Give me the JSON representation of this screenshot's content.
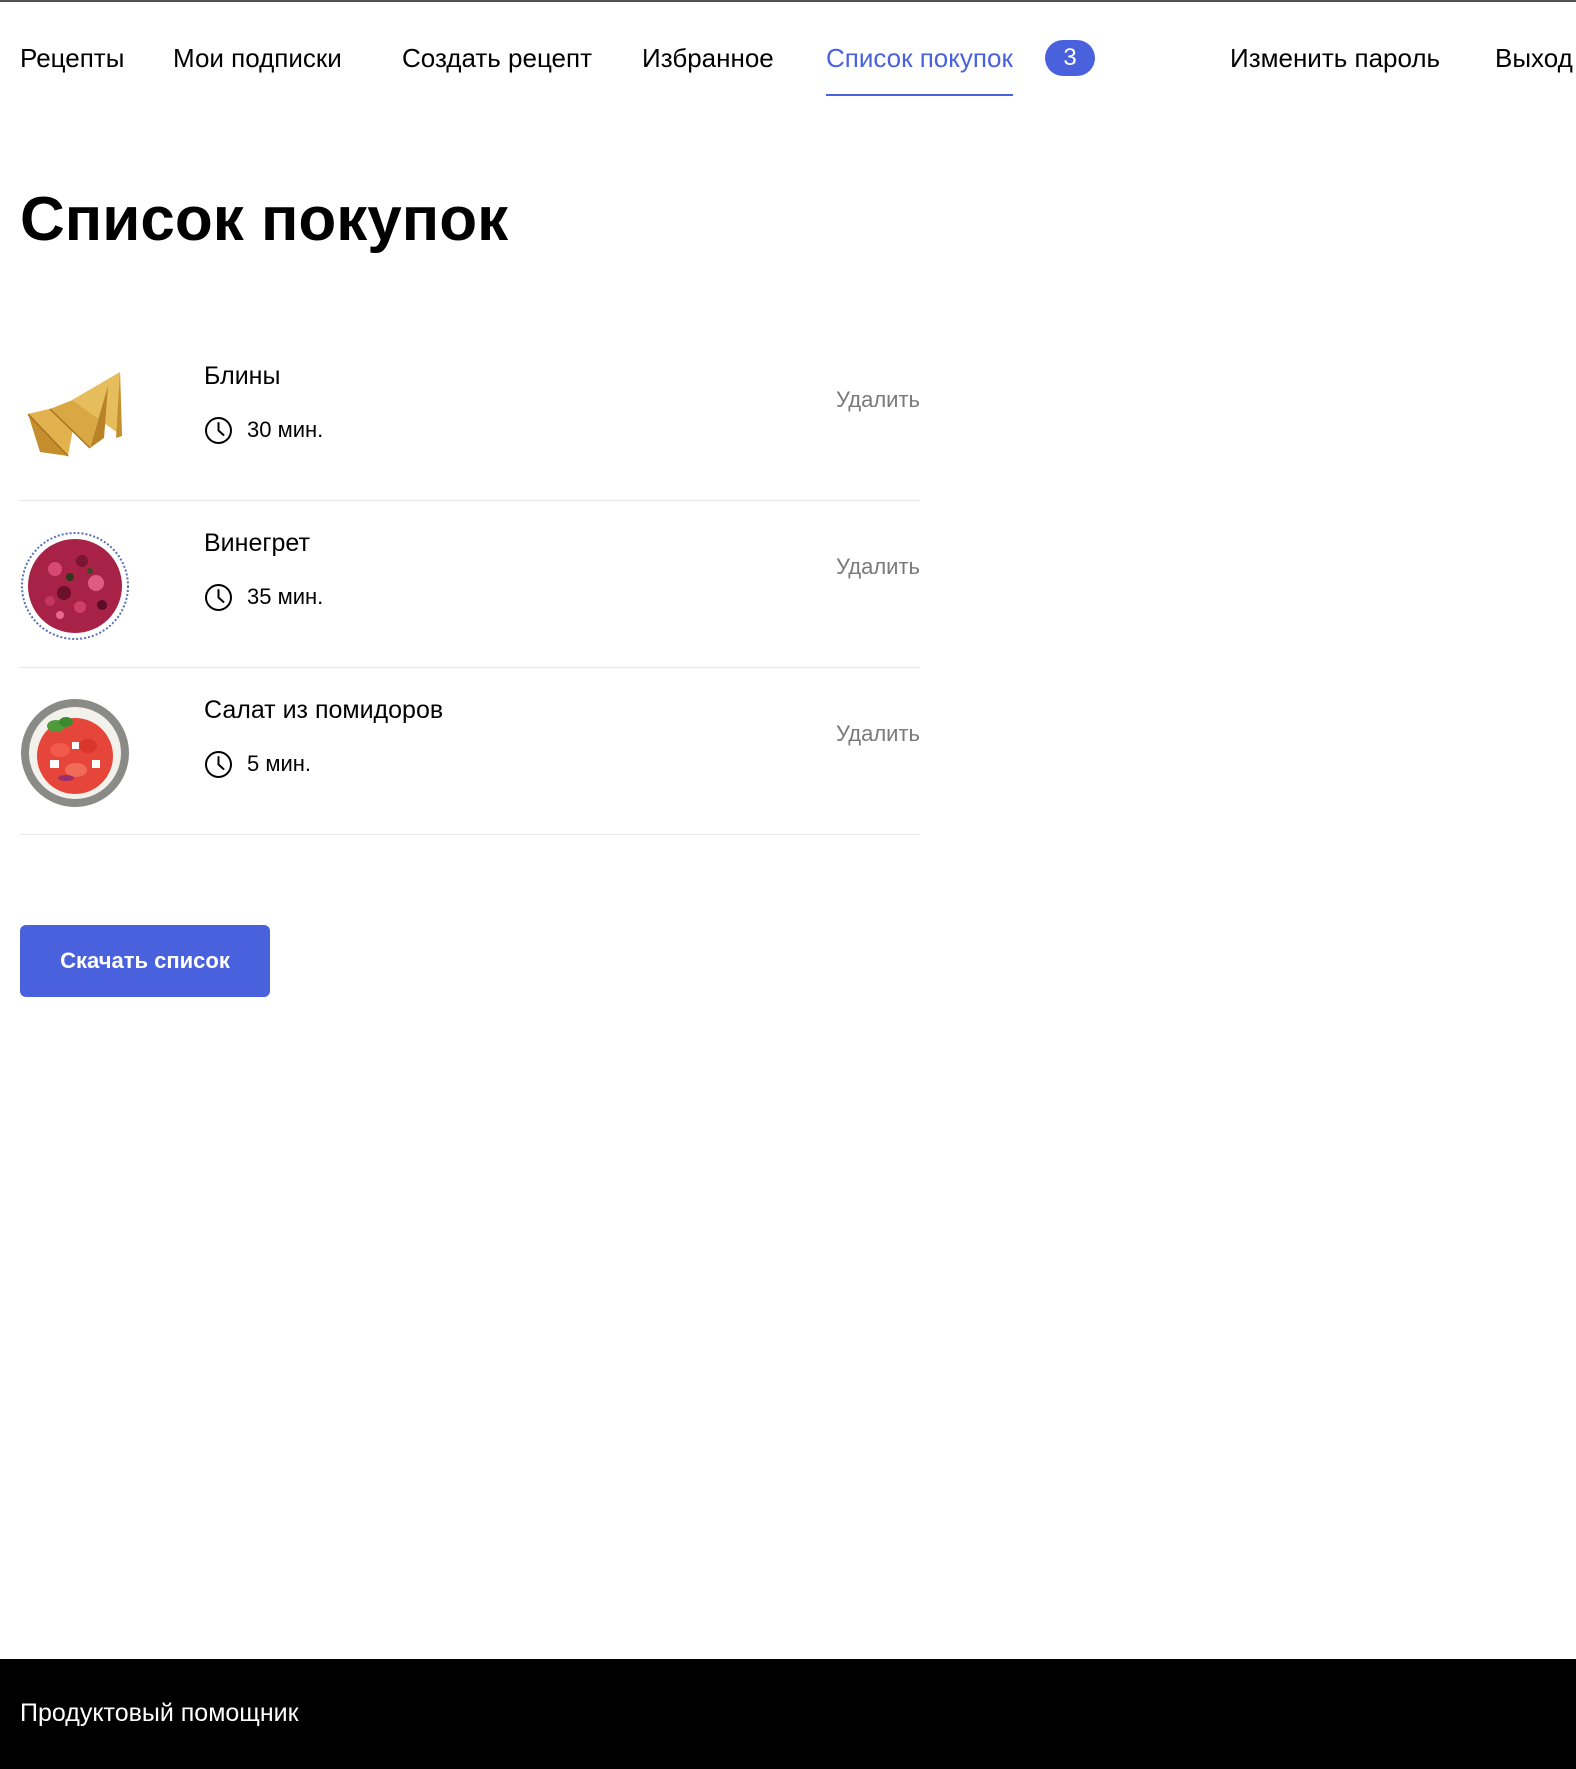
{
  "nav": {
    "recipes": "Рецепты",
    "subscriptions": "Мои подписки",
    "create_recipe": "Создать рецепт",
    "favorites": "Избранное",
    "shopping_list": "Список покупок",
    "shopping_count": "3",
    "change_password": "Изменить пароль",
    "logout": "Выход",
    "accent_color": "#4a61dd"
  },
  "page": {
    "title": "Список покупок"
  },
  "items": [
    {
      "name": "Блины",
      "time": "30 мин.",
      "delete_label": "Удалить",
      "image": "pancakes-photo"
    },
    {
      "name": "Винегрет",
      "time": "35 мин.",
      "delete_label": "Удалить",
      "image": "vinaigrette-photo"
    },
    {
      "name": "Салат из помидоров",
      "time": "5 мин.",
      "delete_label": "Удалить",
      "image": "tomato-salad-photo"
    }
  ],
  "download": {
    "label": "Скачать список"
  },
  "footer": {
    "brand": "Продуктовый помощник"
  }
}
